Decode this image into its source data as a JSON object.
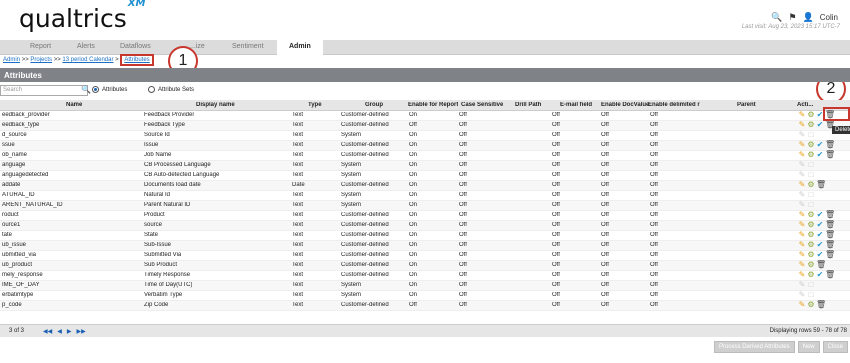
{
  "header": {
    "logo": "qualtrics",
    "logo_super": "XM",
    "user": "Colin",
    "last_visit": "Last visit: Aug 23, 2023 15:17 UTC-7"
  },
  "nav": {
    "tabs": [
      "Report",
      "Alerts",
      "Dataflows",
      "...ize",
      "Sentiment",
      "Admin"
    ]
  },
  "breadcrumb": {
    "items": [
      "Admin",
      "Projects",
      "13 period Calendar",
      "Attributes"
    ],
    "sep": ">>"
  },
  "annotations": [
    "1",
    "2"
  ],
  "section": {
    "title": "Attributes"
  },
  "filter": {
    "search_placeholder": "Search",
    "radio_attributes": "Attributes",
    "radio_attribute_sets": "Attribute Sets"
  },
  "table": {
    "columns": [
      "Name",
      "Display name",
      "Type",
      "Group",
      "Enable for Reporti",
      "Case Sensitive",
      "Drill Path",
      "E-mail field",
      "Enable DocValue",
      "Enable delimited r",
      "Parent",
      "Acti..."
    ],
    "rows": [
      {
        "name": "eedback_provider",
        "display": "Feedback Provider",
        "type": "Text",
        "group": "Customer-defined",
        "report": "On",
        "case": "Off",
        "drill": "",
        "email": "Off",
        "docval": "Off",
        "delim": "Off",
        "parent": "",
        "actions": "full"
      },
      {
        "name": "eedback_type",
        "display": "Feedback Type",
        "type": "Text",
        "group": "Customer-defined",
        "report": "Off",
        "case": "Off",
        "drill": "",
        "email": "Off",
        "docval": "Off",
        "delim": "Off",
        "parent": "",
        "actions": "full"
      },
      {
        "name": "d_source",
        "display": "Source Id",
        "type": "Text",
        "group": "System",
        "report": "On",
        "case": "Off",
        "drill": "",
        "email": "Off",
        "docval": "Off",
        "delim": "Off",
        "parent": "",
        "actions": "none"
      },
      {
        "name": "ssue",
        "display": "Issue",
        "type": "Text",
        "group": "Customer-defined",
        "report": "On",
        "case": "Off",
        "drill": "",
        "email": "Off",
        "docval": "Off",
        "delim": "Off",
        "parent": "",
        "actions": "full"
      },
      {
        "name": "ob_name",
        "display": "Job Name",
        "type": "Text",
        "group": "Customer-defined",
        "report": "On",
        "case": "Off",
        "drill": "",
        "email": "Off",
        "docval": "Off",
        "delim": "Off",
        "parent": "",
        "actions": "full"
      },
      {
        "name": "anguage",
        "display": "CB Processed Language",
        "type": "Text",
        "group": "System",
        "report": "On",
        "case": "Off",
        "drill": "",
        "email": "Off",
        "docval": "Off",
        "delim": "Off",
        "parent": "",
        "actions": "none"
      },
      {
        "name": "anguagedetected",
        "display": "CB Auto-detected Language",
        "type": "Text",
        "group": "System",
        "report": "On",
        "case": "Off",
        "drill": "",
        "email": "Off",
        "docval": "Off",
        "delim": "Off",
        "parent": "",
        "actions": "none"
      },
      {
        "name": "addate",
        "display": "Documents load date",
        "type": "Date",
        "group": "Customer-defined",
        "report": "On",
        "case": "Off",
        "drill": "",
        "email": "Off",
        "docval": "Off",
        "delim": "Off",
        "parent": "",
        "actions": "partial"
      },
      {
        "name": "ATURAL_ID",
        "display": "Natural Id",
        "type": "Text",
        "group": "System",
        "report": "On",
        "case": "Off",
        "drill": "",
        "email": "Off",
        "docval": "Off",
        "delim": "Off",
        "parent": "",
        "actions": "none"
      },
      {
        "name": "ARENT_NATURAL_ID",
        "display": "Parent Natural ID",
        "type": "Text",
        "group": "System",
        "report": "On",
        "case": "Off",
        "drill": "",
        "email": "Off",
        "docval": "Off",
        "delim": "Off",
        "parent": "",
        "actions": "none"
      },
      {
        "name": "roduct",
        "display": "Product",
        "type": "Text",
        "group": "Customer-defined",
        "report": "On",
        "case": "Off",
        "drill": "",
        "email": "Off",
        "docval": "Off",
        "delim": "Off",
        "parent": "",
        "actions": "full"
      },
      {
        "name": "ource1",
        "display": "source",
        "type": "Text",
        "group": "Customer-defined",
        "report": "On",
        "case": "Off",
        "drill": "",
        "email": "Off",
        "docval": "Off",
        "delim": "Off",
        "parent": "",
        "actions": "full"
      },
      {
        "name": "tate",
        "display": "State",
        "type": "Text",
        "group": "Customer-defined",
        "report": "On",
        "case": "Off",
        "drill": "",
        "email": "Off",
        "docval": "Off",
        "delim": "Off",
        "parent": "",
        "actions": "full"
      },
      {
        "name": "ub_issue",
        "display": "Sub-Issue",
        "type": "Text",
        "group": "Customer-defined",
        "report": "On",
        "case": "Off",
        "drill": "",
        "email": "Off",
        "docval": "Off",
        "delim": "Off",
        "parent": "",
        "actions": "full"
      },
      {
        "name": "ubmitted_via",
        "display": "Submitted Via",
        "type": "Text",
        "group": "Customer-defined",
        "report": "On",
        "case": "Off",
        "drill": "",
        "email": "Off",
        "docval": "Off",
        "delim": "Off",
        "parent": "",
        "actions": "full"
      },
      {
        "name": "ub_product",
        "display": "Sub Product",
        "type": "Text",
        "group": "Customer-defined",
        "report": "On",
        "case": "Off",
        "drill": "",
        "email": "Off",
        "docval": "Off",
        "delim": "Off",
        "parent": "",
        "actions": "partial"
      },
      {
        "name": "mely_response",
        "display": "Timely Response",
        "type": "Text",
        "group": "Customer-defined",
        "report": "On",
        "case": "Off",
        "drill": "",
        "email": "Off",
        "docval": "Off",
        "delim": "Off",
        "parent": "",
        "actions": "full"
      },
      {
        "name": "IME_OF_DAY",
        "display": "Time of Day(UTC)",
        "type": "Text",
        "group": "System",
        "report": "On",
        "case": "Off",
        "drill": "",
        "email": "Off",
        "docval": "Off",
        "delim": "Off",
        "parent": "",
        "actions": "none"
      },
      {
        "name": "erbatimtype",
        "display": "Verbatim Type",
        "type": "Text",
        "group": "System",
        "report": "On",
        "case": "Off",
        "drill": "",
        "email": "Off",
        "docval": "Off",
        "delim": "Off",
        "parent": "",
        "actions": "none"
      },
      {
        "name": "p_code",
        "display": "Zip Code",
        "type": "Text",
        "group": "Customer-defined",
        "report": "Off",
        "case": "Off",
        "drill": "",
        "email": "Off",
        "docval": "Off",
        "delim": "Off",
        "parent": "",
        "actions": "partial"
      }
    ]
  },
  "tooltip": "Delete",
  "pager": {
    "pages": "3 of 3",
    "display": "Displaying rows 59 - 78 of 78"
  },
  "buttons": {
    "process": "Process Derived Attributes",
    "new": "New",
    "close": "Close"
  },
  "colors": {
    "accent_red": "#c8372d",
    "link_blue": "#1a6fc4",
    "header_gray": "#7f8287"
  }
}
